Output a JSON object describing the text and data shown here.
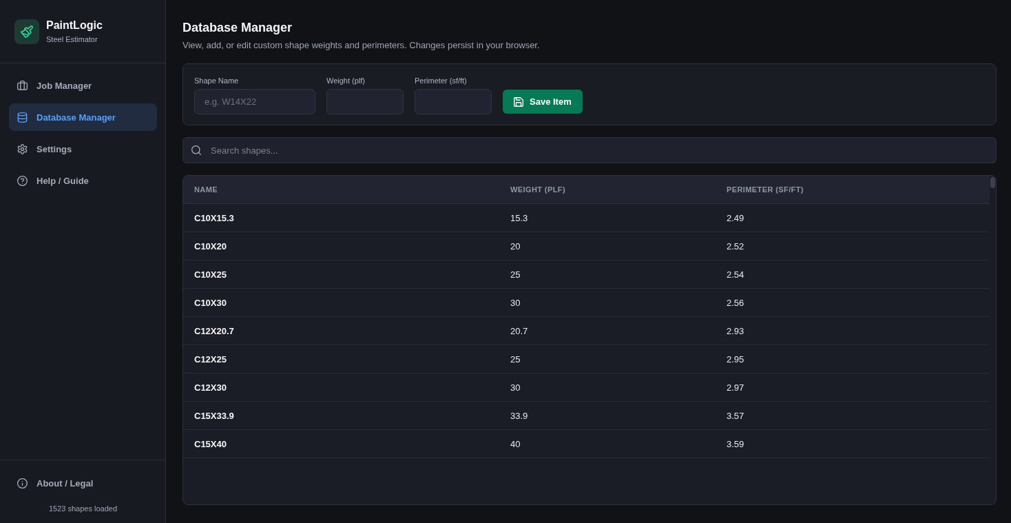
{
  "sidebar": {
    "brand": {
      "title": "PaintLogic",
      "subtitle": "Steel Estimator"
    },
    "nav_items": [
      {
        "label": "Job Manager",
        "selected": false
      },
      {
        "label": "Database Manager",
        "selected": true
      },
      {
        "label": "Settings",
        "selected": false
      },
      {
        "label": "Help / Guide",
        "selected": false
      }
    ],
    "footer": {
      "link": "About / Legal",
      "status": "1523 shapes loaded"
    }
  },
  "main": {
    "title": "Database Manager",
    "subtitle": "View, add, or edit custom shape weights and perimeters. Changes persist in your browser.",
    "form": {
      "fields": [
        {
          "label": "Shape Name",
          "placeholder": "e.g. W14X22"
        },
        {
          "label": "Weight (plf)"
        },
        {
          "label": "Perimeter (sf/ft)"
        }
      ],
      "button": "Save Item"
    },
    "search": {
      "placeholder": "Search shapes..."
    },
    "table": {
      "columns": [
        "NAME",
        "WEIGHT (PLF)",
        "PERIMETER (SF/FT)"
      ],
      "rows": [
        [
          "C10X15.3",
          "15.3",
          "2.49"
        ],
        [
          "C10X20",
          "20",
          "2.52"
        ],
        [
          "C10X25",
          "25",
          "2.54"
        ],
        [
          "C10X30",
          "30",
          "2.56"
        ],
        [
          "C12X20.7",
          "20.7",
          "2.93"
        ],
        [
          "C12X25",
          "25",
          "2.95"
        ],
        [
          "C12X30",
          "30",
          "2.97"
        ],
        [
          "C15X33.9",
          "33.9",
          "3.57"
        ],
        [
          "C15X40",
          "40",
          "3.59"
        ]
      ]
    }
  }
}
